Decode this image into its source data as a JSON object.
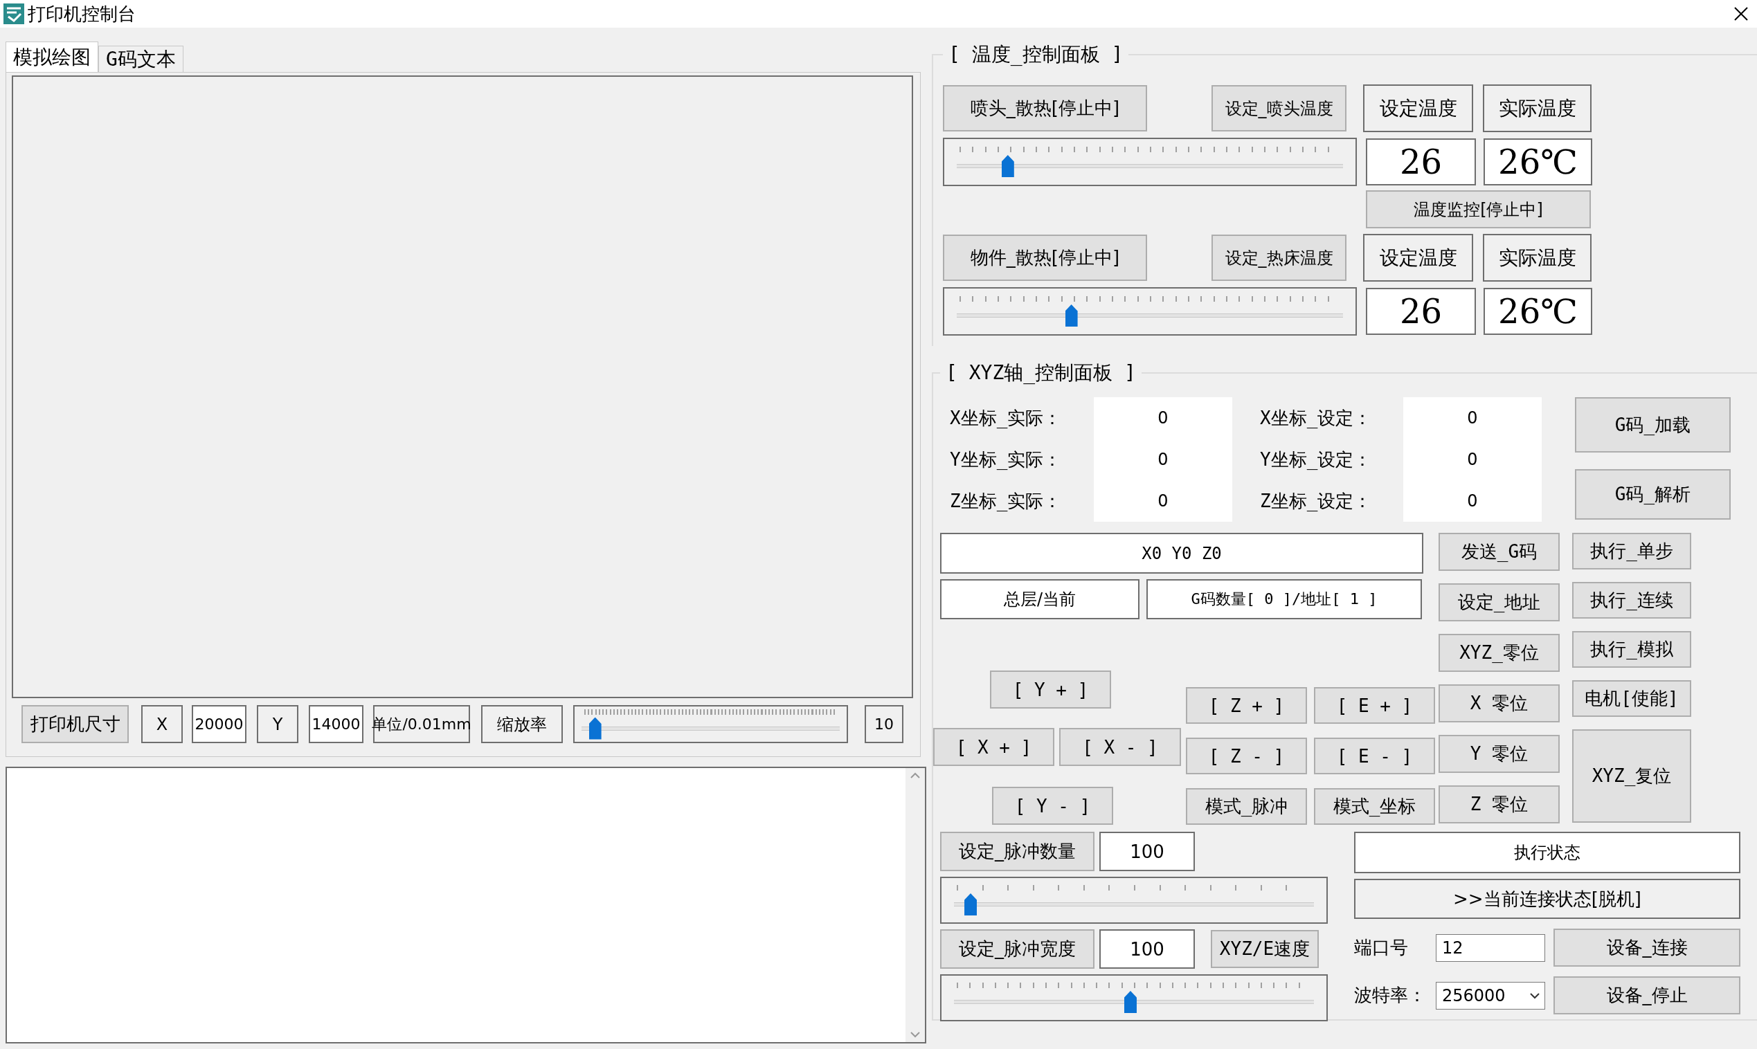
{
  "window": {
    "title": "打印机控制台"
  },
  "tabs": [
    {
      "label": "模拟绘图",
      "selected": true
    },
    {
      "label": "G码文本",
      "selected": false
    }
  ],
  "printer_size_bar": {
    "size_button": "打印机尺寸",
    "x_label": "X",
    "x_value": "20000",
    "y_label": "Y",
    "y_value": "14000",
    "unit_label": "单位/0.01mm",
    "zoom_label": "缩放率",
    "zoom_slider": {
      "level": 0.03
    },
    "zoom_value": "10"
  },
  "temperature_panel": {
    "title": "[ 温度_控制面板 ]",
    "nozzle": {
      "fan_button": "喷头_散热[停止中]",
      "set_button": "设定_喷头温度",
      "set_header": "设定温度",
      "actual_header": "实际温度",
      "slider": {
        "level": 0.12
      },
      "set_value": "26",
      "actual_value": "26℃"
    },
    "monitor_button": "温度监控[停止中]",
    "bed": {
      "fan_button": "物件_散热[停止中]",
      "set_button": "设定_热床温度",
      "set_header": "设定温度",
      "actual_header": "实际温度",
      "slider": {
        "level": 0.29
      },
      "set_value": "26",
      "actual_value": "26℃"
    }
  },
  "xyz_panel": {
    "title": "[ XYZ轴_控制面板 ]",
    "coordinates": [
      {
        "actual_label": "X坐标_实际：",
        "actual_value": "0",
        "set_label": "X坐标_设定：",
        "set_value": "0"
      },
      {
        "actual_label": "Y坐标_实际：",
        "actual_value": "0",
        "set_label": "Y坐标_设定：",
        "set_value": "0"
      },
      {
        "actual_label": "Z坐标_实际：",
        "actual_value": "0",
        "set_label": "Z坐标_设定：",
        "set_value": "0"
      }
    ],
    "gcode_buttons": [
      "G码_加载",
      "G码_解析"
    ],
    "command_field": "X0 Y0 Z0",
    "layer_box": "总层/当前",
    "gcode_count": "G码数量[ 0 ]/地址[ 1 ]",
    "jog_buttons": {
      "y_plus": "[ Y + ]",
      "x_plus": "[ X + ]",
      "x_minus": "[ X - ]",
      "y_minus": "[ Y - ]"
    },
    "axis_grid": [
      [
        "[ Z + ]",
        "[ E + ]"
      ],
      [
        "[ Z - ]",
        "[ E - ]"
      ],
      [
        "模式_脉冲",
        "模式_坐标"
      ]
    ],
    "column_d": [
      "发送_G码",
      "设定_地址",
      "XYZ_零位",
      "X 零位",
      "Y 零位",
      "Z 零位"
    ],
    "column_e": [
      "执行_单步",
      "执行_连续",
      "执行_模拟",
      "电机[使能]",
      "XYZ_复位"
    ]
  },
  "pulse": {
    "count_button": "设定_脉冲数量",
    "count_value": "100",
    "count_slider": {
      "level": 0.03
    },
    "width_button": "设定_脉冲宽度",
    "width_value": "100",
    "speed_button": "XYZ/E速度",
    "width_slider": {
      "level": 0.49
    }
  },
  "connection": {
    "exec_state": "执行状态",
    "status": ">>当前连接状态[脱机]",
    "port_label": "端口号",
    "port_value": "12",
    "connect_button": "设备_连接",
    "baud_label": "波特率：",
    "baud_value": "256000",
    "stop_button": "设备_停止"
  }
}
